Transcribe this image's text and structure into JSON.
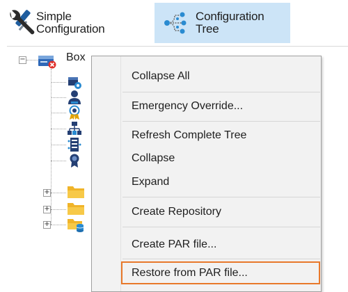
{
  "toolbar": {
    "simple": {
      "line1": "Simple",
      "line2": "Configuration"
    },
    "config": {
      "line1": "Configuration",
      "line2": "Tree"
    },
    "active_bg": "#cce4f7"
  },
  "tree": {
    "root_label": "Box",
    "root_expander": "−",
    "children": [
      {
        "icon": "box-settings-icon"
      },
      {
        "icon": "user-icon"
      },
      {
        "icon": "certificate-badge-icon"
      },
      {
        "icon": "network-hierarchy-icon"
      },
      {
        "icon": "server-rack-icon"
      },
      {
        "icon": "award-ribbon-icon"
      },
      {
        "icon": "folder-icon",
        "expander": "+"
      },
      {
        "icon": "folder-icon",
        "expander": "+"
      },
      {
        "icon": "folder-database-icon",
        "expander": "+"
      }
    ]
  },
  "context_menu": {
    "items": [
      {
        "label": "Collapse All"
      },
      {
        "label": "Emergency Override..."
      },
      {
        "label": "Refresh Complete Tree"
      },
      {
        "label": "Collapse"
      },
      {
        "label": "Expand"
      },
      {
        "label": "Create Repository"
      },
      {
        "label": "Create PAR file..."
      },
      {
        "label": "Restore from PAR file..."
      }
    ],
    "highlight_color": "#e8782a"
  }
}
